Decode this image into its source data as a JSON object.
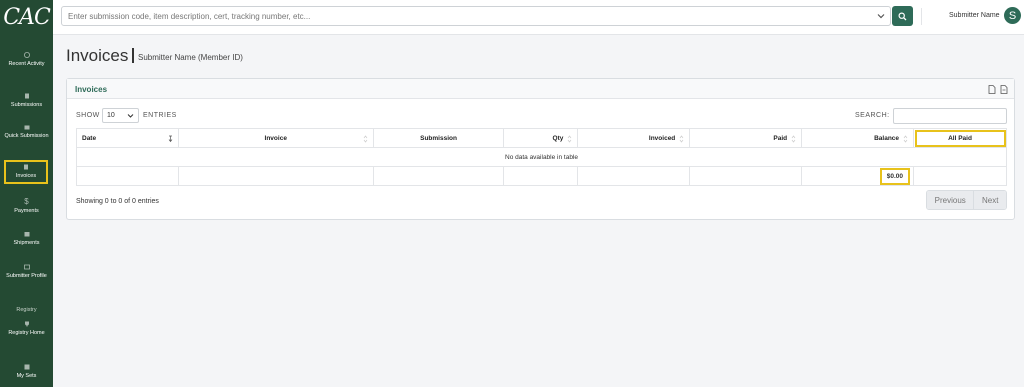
{
  "brand": {
    "logo_text": "CAC"
  },
  "sidebar": {
    "items": [
      {
        "label": "Recent Activity",
        "icon": "clock-icon"
      },
      {
        "label": "Submissions",
        "icon": "document-icon"
      },
      {
        "label": "Quick Submission",
        "icon": "folder-icon"
      },
      {
        "label": "Invoices",
        "icon": "invoice-icon",
        "active": true
      },
      {
        "label": "Payments",
        "icon": "dollar-icon"
      },
      {
        "label": "Shipments",
        "icon": "box-icon"
      },
      {
        "label": "Submitter Profile",
        "icon": "id-card-icon"
      },
      {
        "label": "Registry Home",
        "icon": "trophy-icon"
      },
      {
        "label": "My Sets",
        "icon": "list-icon"
      }
    ],
    "section_label": "Registry"
  },
  "topbar": {
    "search_placeholder": "Enter submission code, item description, cert, tracking number, etc...",
    "user_name": "Submitter Name",
    "avatar_initial": "S"
  },
  "page": {
    "title": "Invoices",
    "subtitle": "Submitter Name (Member ID)"
  },
  "card": {
    "title": "Invoices",
    "show_label": "SHOW",
    "entries_value": "10",
    "entries_label": "ENTRIES",
    "search_label": "SEARCH:",
    "columns": [
      "Date",
      "Invoice",
      "Submission",
      "Qty",
      "Invoiced",
      "Paid",
      "Balance",
      "All Paid"
    ],
    "empty_message": "No data available in table",
    "footer_balance": "$0.00",
    "info": "Showing 0 to 0 of 0 entries",
    "prev_label": "Previous",
    "next_label": "Next"
  },
  "colors": {
    "sidebar_bg": "#244a33",
    "accent": "#2e6b58",
    "highlight": "#e8c21b"
  }
}
